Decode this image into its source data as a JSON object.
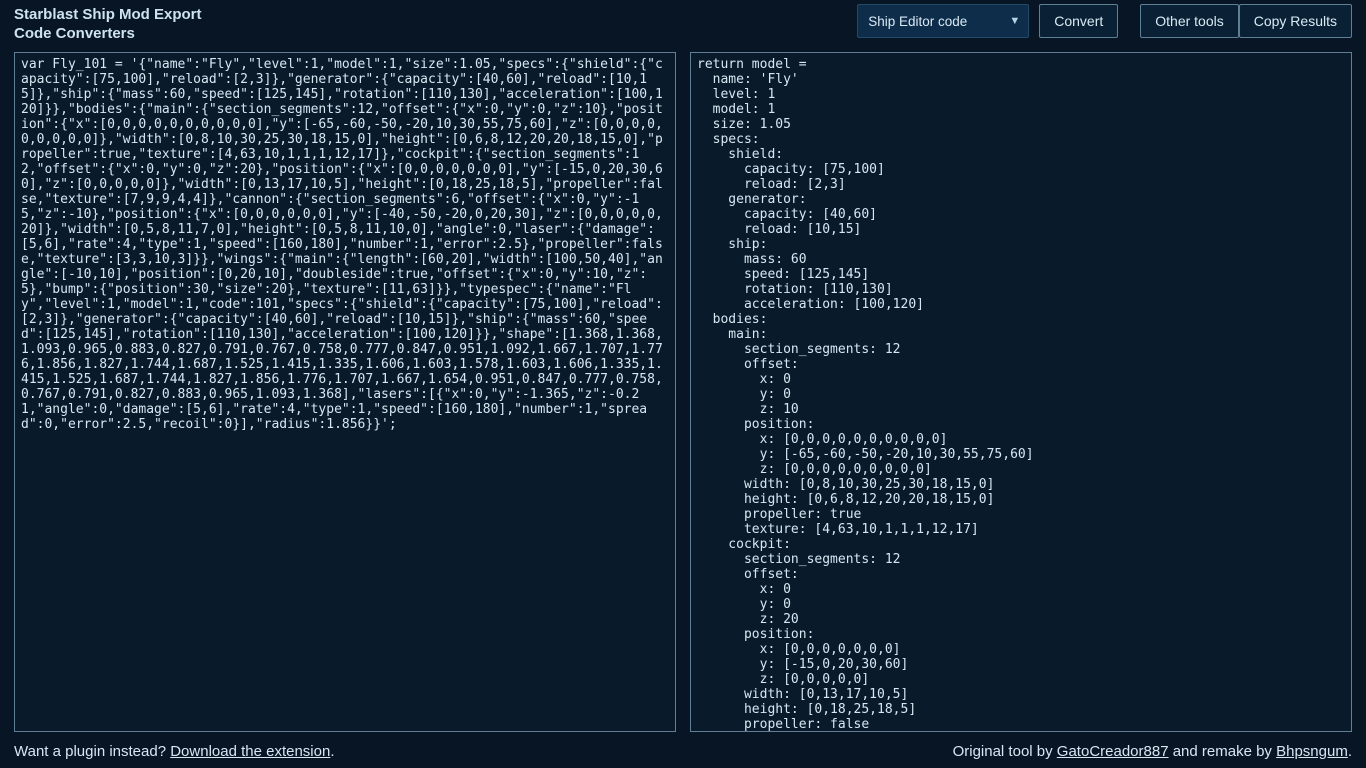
{
  "header": {
    "title_line1": "Starblast Ship Mod Export",
    "title_line2": "Code Converters",
    "select_label": "Ship Editor code",
    "convert_label": "Convert",
    "other_tools_label": "Other tools",
    "copy_results_label": "Copy Results"
  },
  "footer": {
    "plugin_prefix": "Want a plugin instead? ",
    "plugin_link": "Download the extension",
    "plugin_suffix": ".",
    "credit_prefix": "Original tool by ",
    "credit_author1": "GatoCreador887",
    "credit_mid": " and remake by ",
    "credit_author2": "Bhpsngum",
    "credit_suffix": "."
  },
  "left_code": "var Fly_101 = '{\"name\":\"Fly\",\"level\":1,\"model\":1,\"size\":1.05,\"specs\":{\"shield\":{\"capacity\":[75,100],\"reload\":[2,3]},\"generator\":{\"capacity\":[40,60],\"reload\":[10,15]},\"ship\":{\"mass\":60,\"speed\":[125,145],\"rotation\":[110,130],\"acceleration\":[100,120]}},\"bodies\":{\"main\":{\"section_segments\":12,\"offset\":{\"x\":0,\"y\":0,\"z\":10},\"position\":{\"x\":[0,0,0,0,0,0,0,0,0,0],\"y\":[-65,-60,-50,-20,10,30,55,75,60],\"z\":[0,0,0,0,0,0,0,0,0]},\"width\":[0,8,10,30,25,30,18,15,0],\"height\":[0,6,8,12,20,20,18,15,0],\"propeller\":true,\"texture\":[4,63,10,1,1,1,12,17]},\"cockpit\":{\"section_segments\":12,\"offset\":{\"x\":0,\"y\":0,\"z\":20},\"position\":{\"x\":[0,0,0,0,0,0,0],\"y\":[-15,0,20,30,60],\"z\":[0,0,0,0,0]},\"width\":[0,13,17,10,5],\"height\":[0,18,25,18,5],\"propeller\":false,\"texture\":[7,9,9,4,4]},\"cannon\":{\"section_segments\":6,\"offset\":{\"x\":0,\"y\":-15,\"z\":-10},\"position\":{\"x\":[0,0,0,0,0,0],\"y\":[-40,-50,-20,0,20,30],\"z\":[0,0,0,0,0,20]},\"width\":[0,5,8,11,7,0],\"height\":[0,5,8,11,10,0],\"angle\":0,\"laser\":{\"damage\":[5,6],\"rate\":4,\"type\":1,\"speed\":[160,180],\"number\":1,\"error\":2.5},\"propeller\":false,\"texture\":[3,3,10,3]}},\"wings\":{\"main\":{\"length\":[60,20],\"width\":[100,50,40],\"angle\":[-10,10],\"position\":[0,20,10],\"doubleside\":true,\"offset\":{\"x\":0,\"y\":10,\"z\":5},\"bump\":{\"position\":30,\"size\":20},\"texture\":[11,63]}},\"typespec\":{\"name\":\"Fly\",\"level\":1,\"model\":1,\"code\":101,\"specs\":{\"shield\":{\"capacity\":[75,100],\"reload\":[2,3]},\"generator\":{\"capacity\":[40,60],\"reload\":[10,15]},\"ship\":{\"mass\":60,\"speed\":[125,145],\"rotation\":[110,130],\"acceleration\":[100,120]}},\"shape\":[1.368,1.368,1.093,0.965,0.883,0.827,0.791,0.767,0.758,0.777,0.847,0.951,1.092,1.667,1.707,1.776,1.856,1.827,1.744,1.687,1.525,1.415,1.335,1.606,1.603,1.578,1.603,1.606,1.335,1.415,1.525,1.687,1.744,1.827,1.856,1.776,1.707,1.667,1.654,0.951,0.847,0.777,0.758,0.767,0.791,0.827,0.883,0.965,1.093,1.368],\"lasers\":[{\"x\":0,\"y\":-1.365,\"z\":-0.21,\"angle\":0,\"damage\":[5,6],\"rate\":4,\"type\":1,\"speed\":[160,180],\"number\":1,\"spread\":0,\"error\":2.5,\"recoil\":0}],\"radius\":1.856}}';",
  "right_code": "return model =\n  name: 'Fly'\n  level: 1\n  model: 1\n  size: 1.05\n  specs:\n    shield:\n      capacity: [75,100]\n      reload: [2,3]\n    generator:\n      capacity: [40,60]\n      reload: [10,15]\n    ship:\n      mass: 60\n      speed: [125,145]\n      rotation: [110,130]\n      acceleration: [100,120]\n  bodies:\n    main:\n      section_segments: 12\n      offset:\n        x: 0\n        y: 0\n        z: 10\n      position:\n        x: [0,0,0,0,0,0,0,0,0,0]\n        y: [-65,-60,-50,-20,10,30,55,75,60]\n        z: [0,0,0,0,0,0,0,0,0]\n      width: [0,8,10,30,25,30,18,15,0]\n      height: [0,6,8,12,20,20,18,15,0]\n      propeller: true\n      texture: [4,63,10,1,1,1,12,17]\n    cockpit:\n      section_segments: 12\n      offset:\n        x: 0\n        y: 0\n        z: 20\n      position:\n        x: [0,0,0,0,0,0,0]\n        y: [-15,0,20,30,60]\n        z: [0,0,0,0,0]\n      width: [0,13,17,10,5]\n      height: [0,18,25,18,5]\n      propeller: false\n"
}
